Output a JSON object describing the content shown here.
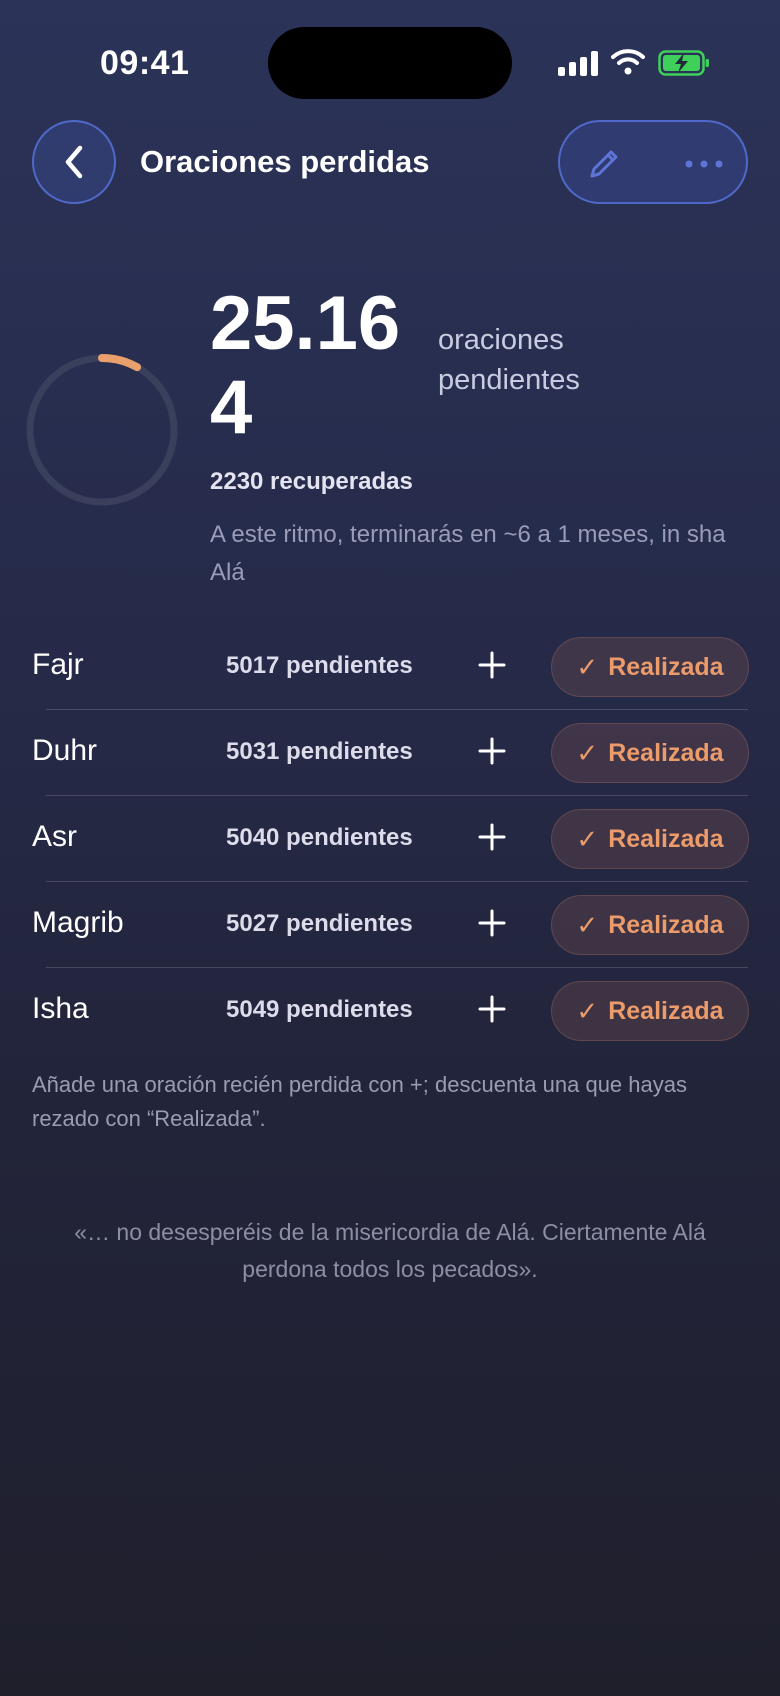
{
  "status_bar": {
    "time": "09:41"
  },
  "header": {
    "title": "Oraciones perdidas",
    "back_icon": "chevron-left-icon",
    "edit_icon": "pencil-icon",
    "more_icon": "ellipsis-icon",
    "accent_color": "#5a78e6"
  },
  "summary": {
    "pending_total": "25.164",
    "pending_label": "oraciones pendientes",
    "recovered": "2230 recuperadas",
    "estimate": "A este ritmo, terminarás en ~6 a 1 meses, in sha Alá",
    "progress_fraction": 0.081,
    "progress_color": "#e9a06c"
  },
  "prayers": [
    {
      "name": "Fajr",
      "pending": "5017 pendientes",
      "done_label": "Realizada"
    },
    {
      "name": "Duhr",
      "pending": "5031 pendientes",
      "done_label": "Realizada"
    },
    {
      "name": "Asr",
      "pending": "5040 pendientes",
      "done_label": "Realizada"
    },
    {
      "name": "Magrib",
      "pending": "5027 pendientes",
      "done_label": "Realizada"
    },
    {
      "name": "Isha",
      "pending": "5049 pendientes",
      "done_label": "Realizada"
    }
  ],
  "hint": "Añade una oración recién perdida con +; descuenta una que hayas rezado con “Realizada”.",
  "quote": "«… no desesperéis de la misericordia de Alá. Ciertamente Alá perdona todos los pecados».",
  "colors": {
    "done_accent": "#ec9b6b"
  }
}
